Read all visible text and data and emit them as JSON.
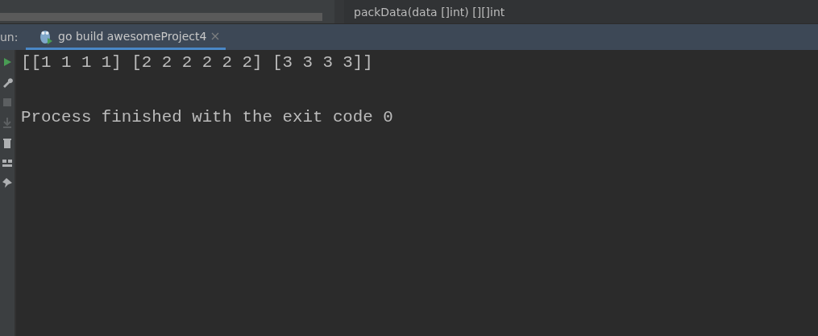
{
  "breadcrumb": {
    "text": "packData(data []int) [][]int"
  },
  "run_panel": {
    "label": "un:",
    "tabs": [
      {
        "label": "go build awesomeProject4",
        "selected": true,
        "closable": true
      }
    ]
  },
  "toolbar": [
    {
      "kind": "play",
      "disabled": false
    },
    {
      "kind": "wrench",
      "disabled": false
    },
    {
      "kind": "stop",
      "disabled": true
    },
    {
      "kind": "download",
      "disabled": true
    },
    {
      "kind": "trash",
      "disabled": false
    },
    {
      "kind": "layout",
      "disabled": false
    },
    {
      "kind": "pin",
      "disabled": false
    }
  ],
  "console": [
    {
      "kind": "output",
      "text": "[[1 1 1 1] [2 2 2 2 2 2] [3 3 3 3]]"
    },
    {
      "kind": "status",
      "text": "Process finished with the exit code 0"
    }
  ]
}
